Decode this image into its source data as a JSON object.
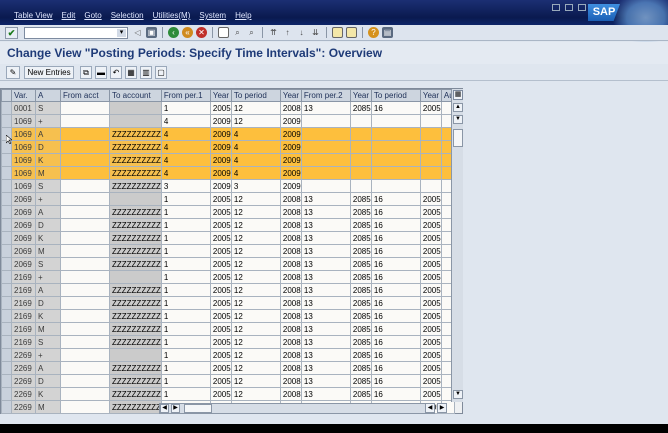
{
  "menu": [
    "Table View",
    "Edit",
    "Goto",
    "Selection",
    "Utilities(M)",
    "System",
    "Help"
  ],
  "logo": "SAP",
  "title": "Change View \"Posting Periods: Specify Time Intervals\": Overview",
  "app_toolbar": {
    "new_entries": "New Entries"
  },
  "columns": [
    "Var.",
    "A",
    "From acct",
    "To account",
    "From per.1",
    "Year",
    "To period",
    "Year",
    "From per.2",
    "Year",
    "To period",
    "Year",
    "Au"
  ],
  "rows": [
    {
      "v": "0001",
      "a": "S",
      "fa": "",
      "ta": "",
      "fp1": "1",
      "y1": "2005",
      "tp1": "12",
      "y2": "2008",
      "fp2": "13",
      "y3": "2085",
      "tp2": "16",
      "y4": "2005",
      "hl": false
    },
    {
      "v": "1069",
      "a": "+",
      "fa": "",
      "ta": "",
      "fp1": "4",
      "y1": "2009",
      "tp1": "12",
      "y2": "2009",
      "fp2": "",
      "y3": "",
      "tp2": "",
      "y4": "",
      "hl": false
    },
    {
      "v": "1069",
      "a": "A",
      "fa": "",
      "ta": "ZZZZZZZZZZ",
      "fp1": "4",
      "y1": "2009",
      "tp1": "4",
      "y2": "2009",
      "fp2": "",
      "y3": "",
      "tp2": "",
      "y4": "",
      "hl": true
    },
    {
      "v": "1069",
      "a": "D",
      "fa": "",
      "ta": "ZZZZZZZZZZ",
      "fp1": "4",
      "y1": "2009",
      "tp1": "4",
      "y2": "2009",
      "fp2": "",
      "y3": "",
      "tp2": "",
      "y4": "",
      "hl": true
    },
    {
      "v": "1069",
      "a": "K",
      "fa": "",
      "ta": "ZZZZZZZZZZ",
      "fp1": "4",
      "y1": "2009",
      "tp1": "4",
      "y2": "2009",
      "fp2": "",
      "y3": "",
      "tp2": "",
      "y4": "",
      "hl": true
    },
    {
      "v": "1069",
      "a": "M",
      "fa": "",
      "ta": "ZZZZZZZZZZ",
      "fp1": "4",
      "y1": "2009",
      "tp1": "4",
      "y2": "2009",
      "fp2": "",
      "y3": "",
      "tp2": "",
      "y4": "",
      "hl": true
    },
    {
      "v": "1069",
      "a": "S",
      "fa": "",
      "ta": "ZZZZZZZZZZ",
      "fp1": "3",
      "y1": "2009",
      "tp1": "3",
      "y2": "2009",
      "fp2": "",
      "y3": "",
      "tp2": "",
      "y4": "",
      "hl": false
    },
    {
      "v": "2069",
      "a": "+",
      "fa": "",
      "ta": "",
      "fp1": "1",
      "y1": "2005",
      "tp1": "12",
      "y2": "2008",
      "fp2": "13",
      "y3": "2085",
      "tp2": "16",
      "y4": "2005",
      "hl": false
    },
    {
      "v": "2069",
      "a": "A",
      "fa": "",
      "ta": "ZZZZZZZZZZ",
      "fp1": "1",
      "y1": "2005",
      "tp1": "12",
      "y2": "2008",
      "fp2": "13",
      "y3": "2085",
      "tp2": "16",
      "y4": "2005",
      "hl": false
    },
    {
      "v": "2069",
      "a": "D",
      "fa": "",
      "ta": "ZZZZZZZZZZ",
      "fp1": "1",
      "y1": "2005",
      "tp1": "12",
      "y2": "2008",
      "fp2": "13",
      "y3": "2085",
      "tp2": "16",
      "y4": "2005",
      "hl": false
    },
    {
      "v": "2069",
      "a": "K",
      "fa": "",
      "ta": "ZZZZZZZZZZ",
      "fp1": "1",
      "y1": "2005",
      "tp1": "12",
      "y2": "2008",
      "fp2": "13",
      "y3": "2085",
      "tp2": "16",
      "y4": "2005",
      "hl": false
    },
    {
      "v": "2069",
      "a": "M",
      "fa": "",
      "ta": "ZZZZZZZZZZ",
      "fp1": "1",
      "y1": "2005",
      "tp1": "12",
      "y2": "2008",
      "fp2": "13",
      "y3": "2085",
      "tp2": "16",
      "y4": "2005",
      "hl": false
    },
    {
      "v": "2069",
      "a": "S",
      "fa": "",
      "ta": "ZZZZZZZZZZ",
      "fp1": "1",
      "y1": "2005",
      "tp1": "12",
      "y2": "2008",
      "fp2": "13",
      "y3": "2085",
      "tp2": "16",
      "y4": "2005",
      "hl": false
    },
    {
      "v": "2169",
      "a": "+",
      "fa": "",
      "ta": "",
      "fp1": "1",
      "y1": "2005",
      "tp1": "12",
      "y2": "2008",
      "fp2": "13",
      "y3": "2085",
      "tp2": "16",
      "y4": "2005",
      "hl": false
    },
    {
      "v": "2169",
      "a": "A",
      "fa": "",
      "ta": "ZZZZZZZZZZ",
      "fp1": "1",
      "y1": "2005",
      "tp1": "12",
      "y2": "2008",
      "fp2": "13",
      "y3": "2085",
      "tp2": "16",
      "y4": "2005",
      "hl": false
    },
    {
      "v": "2169",
      "a": "D",
      "fa": "",
      "ta": "ZZZZZZZZZZ",
      "fp1": "1",
      "y1": "2005",
      "tp1": "12",
      "y2": "2008",
      "fp2": "13",
      "y3": "2085",
      "tp2": "16",
      "y4": "2005",
      "hl": false
    },
    {
      "v": "2169",
      "a": "K",
      "fa": "",
      "ta": "ZZZZZZZZZZ",
      "fp1": "1",
      "y1": "2005",
      "tp1": "12",
      "y2": "2008",
      "fp2": "13",
      "y3": "2085",
      "tp2": "16",
      "y4": "2005",
      "hl": false
    },
    {
      "v": "2169",
      "a": "M",
      "fa": "",
      "ta": "ZZZZZZZZZZ",
      "fp1": "1",
      "y1": "2005",
      "tp1": "12",
      "y2": "2008",
      "fp2": "13",
      "y3": "2085",
      "tp2": "16",
      "y4": "2005",
      "hl": false
    },
    {
      "v": "2169",
      "a": "S",
      "fa": "",
      "ta": "ZZZZZZZZZZ",
      "fp1": "1",
      "y1": "2005",
      "tp1": "12",
      "y2": "2008",
      "fp2": "13",
      "y3": "2085",
      "tp2": "16",
      "y4": "2005",
      "hl": false
    },
    {
      "v": "2269",
      "a": "+",
      "fa": "",
      "ta": "",
      "fp1": "1",
      "y1": "2005",
      "tp1": "12",
      "y2": "2008",
      "fp2": "13",
      "y3": "2085",
      "tp2": "16",
      "y4": "2005",
      "hl": false
    },
    {
      "v": "2269",
      "a": "A",
      "fa": "",
      "ta": "ZZZZZZZZZZ",
      "fp1": "1",
      "y1": "2005",
      "tp1": "12",
      "y2": "2008",
      "fp2": "13",
      "y3": "2085",
      "tp2": "16",
      "y4": "2005",
      "hl": false
    },
    {
      "v": "2269",
      "a": "D",
      "fa": "",
      "ta": "ZZZZZZZZZZ",
      "fp1": "1",
      "y1": "2005",
      "tp1": "12",
      "y2": "2008",
      "fp2": "13",
      "y3": "2085",
      "tp2": "16",
      "y4": "2005",
      "hl": false
    },
    {
      "v": "2269",
      "a": "K",
      "fa": "",
      "ta": "ZZZZZZZZZZ",
      "fp1": "1",
      "y1": "2005",
      "tp1": "12",
      "y2": "2008",
      "fp2": "13",
      "y3": "2085",
      "tp2": "16",
      "y4": "2005",
      "hl": false
    },
    {
      "v": "2269",
      "a": "M",
      "fa": "",
      "ta": "ZZZZZZZZZZ",
      "fp1": "1",
      "y1": "2005",
      "tp1": "12",
      "y2": "2008",
      "fp2": "13",
      "y3": "2085",
      "tp2": "16",
      "y4": "2005",
      "hl": false
    }
  ],
  "colors": {
    "highlight": "#fdbf3d",
    "title": "#1f3b78",
    "menubar": "#0a1a4f"
  }
}
